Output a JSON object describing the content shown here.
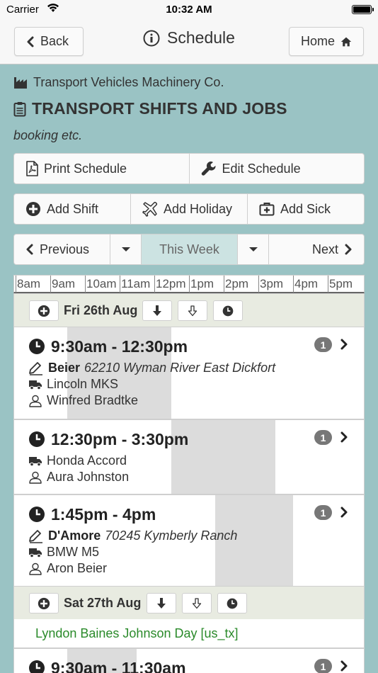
{
  "status_bar": {
    "carrier": "Carrier",
    "time": "10:32 AM"
  },
  "nav": {
    "back_label": "Back",
    "title": "Schedule",
    "home_label": "Home"
  },
  "header": {
    "company": "Transport Vehicles Machinery Co.",
    "title": "TRANSPORT SHIFTS AND JOBS",
    "subtitle": "booking etc."
  },
  "actions": {
    "print_label": "Print Schedule",
    "edit_label": "Edit Schedule",
    "add_shift_label": "Add Shift",
    "add_holiday_label": "Add Holiday",
    "add_sick_label": "Add Sick"
  },
  "week_nav": {
    "previous_label": "Previous",
    "this_week_label": "This Week",
    "next_label": "Next"
  },
  "timeline": {
    "hours": [
      "8am",
      "9am",
      "10am",
      "11am",
      "12pm",
      "1pm",
      "2pm",
      "3pm",
      "4pm",
      "5pm"
    ]
  },
  "days": [
    {
      "label": "Fri 26th Aug",
      "shifts": [
        {
          "time": "9:30am - 12:30pm",
          "count": "1",
          "job_name": "Beier",
          "job_address": "62210 Wyman River East Dickfort",
          "vehicle": "Lincoln MKS",
          "person": "Winfred Bradtke"
        },
        {
          "time": "12:30pm - 3:30pm",
          "count": "1",
          "vehicle": "Honda Accord",
          "person": "Aura Johnston"
        },
        {
          "time": "1:45pm - 4pm",
          "count": "1",
          "job_name": "D'Amore",
          "job_address": "70245 Kymberly Ranch",
          "vehicle": "BMW M5",
          "person": "Aron Beier"
        }
      ]
    },
    {
      "label": "Sat 27th Aug",
      "holiday": "Lyndon Baines Johnson Day [us_tx]",
      "shifts": [
        {
          "time": "9:30am - 11:30am",
          "count": "1"
        }
      ]
    }
  ],
  "colors": {
    "background": "#9ac3c4",
    "holiday_text": "#2a8a2a",
    "shift_shade": "#dcdcdc",
    "badge": "#777777"
  }
}
